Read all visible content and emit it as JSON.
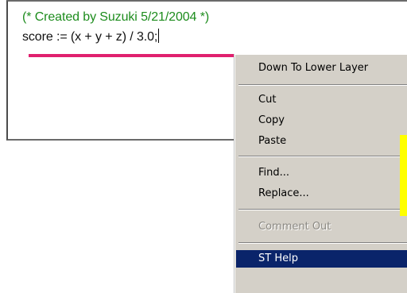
{
  "editor": {
    "comment_line": "(* Created by Suzuki 5/21/2004 *)",
    "code_line": "score := (x + y + z) / 3.0;"
  },
  "context_menu": {
    "items": [
      {
        "label": "Down To Lower Layer",
        "enabled": true
      },
      {
        "label": "Cut",
        "enabled": true
      },
      {
        "label": "Copy",
        "enabled": true
      },
      {
        "label": "Paste",
        "enabled": true
      },
      {
        "label": "Find...",
        "enabled": true
      },
      {
        "label": "Replace...",
        "enabled": true
      },
      {
        "label": "Comment Out",
        "enabled": false
      },
      {
        "label": "ST Help",
        "enabled": true,
        "highlighted": true
      }
    ]
  },
  "colors": {
    "comment_text": "#1d8c1d",
    "underline_mark": "#e0206e",
    "menu_background": "#d4d0c8",
    "menu_highlight": "#0a246a",
    "callout_bar": "#ffff00"
  }
}
